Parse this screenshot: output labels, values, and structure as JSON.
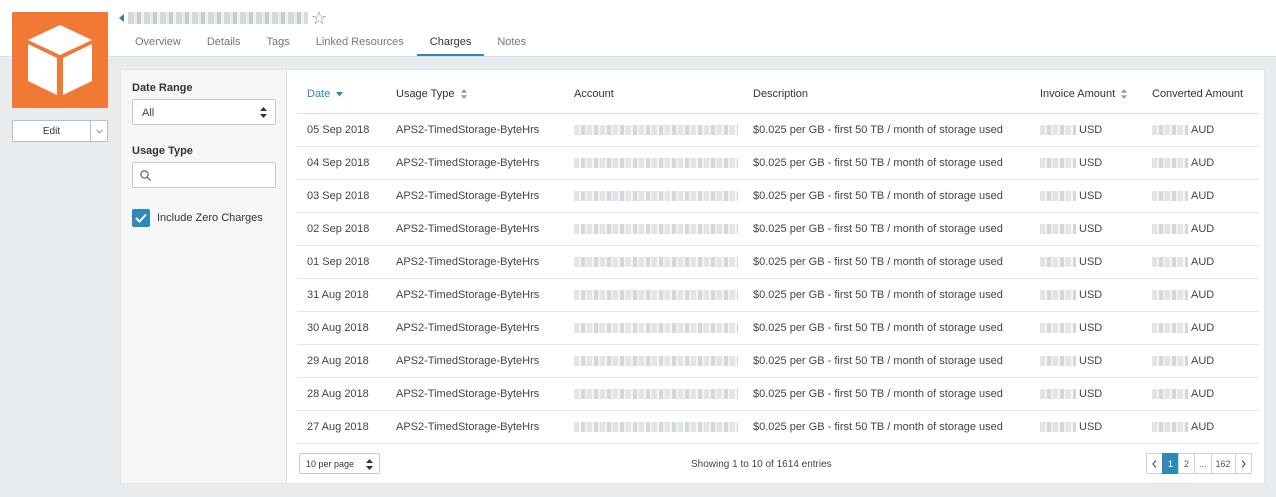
{
  "header": {
    "tabs": [
      {
        "label": "Overview"
      },
      {
        "label": "Details"
      },
      {
        "label": "Tags"
      },
      {
        "label": "Linked Resources"
      },
      {
        "label": "Charges",
        "active": true
      },
      {
        "label": "Notes"
      }
    ],
    "edit_label": "Edit",
    "logo_color": "#f27935"
  },
  "filters": {
    "date_range_label": "Date Range",
    "date_range_value": "All",
    "usage_type_label": "Usage Type",
    "usage_type_placeholder": "",
    "include_zero_label": "Include Zero Charges",
    "include_zero_checked": true
  },
  "table": {
    "columns": [
      "Date",
      "Usage Type",
      "Account",
      "Description",
      "Invoice Amount",
      "Converted Amount"
    ],
    "rows": [
      {
        "date": "05 Sep 2018",
        "usage_type": "APS2-TimedStorage-ByteHrs",
        "description": "$0.025 per GB - first 50 TB / month of storage used",
        "invoice_currency": "USD",
        "converted_currency": "AUD"
      },
      {
        "date": "04 Sep 2018",
        "usage_type": "APS2-TimedStorage-ByteHrs",
        "description": "$0.025 per GB - first 50 TB / month of storage used",
        "invoice_currency": "USD",
        "converted_currency": "AUD"
      },
      {
        "date": "03 Sep 2018",
        "usage_type": "APS2-TimedStorage-ByteHrs",
        "description": "$0.025 per GB - first 50 TB / month of storage used",
        "invoice_currency": "USD",
        "converted_currency": "AUD"
      },
      {
        "date": "02 Sep 2018",
        "usage_type": "APS2-TimedStorage-ByteHrs",
        "description": "$0.025 per GB - first 50 TB / month of storage used",
        "invoice_currency": "USD",
        "converted_currency": "AUD"
      },
      {
        "date": "01 Sep 2018",
        "usage_type": "APS2-TimedStorage-ByteHrs",
        "description": "$0.025 per GB - first 50 TB / month of storage used",
        "invoice_currency": "USD",
        "converted_currency": "AUD"
      },
      {
        "date": "31 Aug 2018",
        "usage_type": "APS2-TimedStorage-ByteHrs",
        "description": "$0.025 per GB - first 50 TB / month of storage used",
        "invoice_currency": "USD",
        "converted_currency": "AUD"
      },
      {
        "date": "30 Aug 2018",
        "usage_type": "APS2-TimedStorage-ByteHrs",
        "description": "$0.025 per GB - first 50 TB / month of storage used",
        "invoice_currency": "USD",
        "converted_currency": "AUD"
      },
      {
        "date": "29 Aug 2018",
        "usage_type": "APS2-TimedStorage-ByteHrs",
        "description": "$0.025 per GB - first 50 TB / month of storage used",
        "invoice_currency": "USD",
        "converted_currency": "AUD"
      },
      {
        "date": "28 Aug 2018",
        "usage_type": "APS2-TimedStorage-ByteHrs",
        "description": "$0.025 per GB - first 50 TB / month of storage used",
        "invoice_currency": "USD",
        "converted_currency": "AUD"
      },
      {
        "date": "27 Aug 2018",
        "usage_type": "APS2-TimedStorage-ByteHrs",
        "description": "$0.025 per GB - first 50 TB / month of storage used",
        "invoice_currency": "USD",
        "converted_currency": "AUD"
      }
    ]
  },
  "footer": {
    "per_page": "10 per page",
    "showing": "Showing 1 to 10 of 1614 entries",
    "pages": [
      "1",
      "2",
      "...",
      "162"
    ],
    "accent_color": "#2e8bb9"
  }
}
